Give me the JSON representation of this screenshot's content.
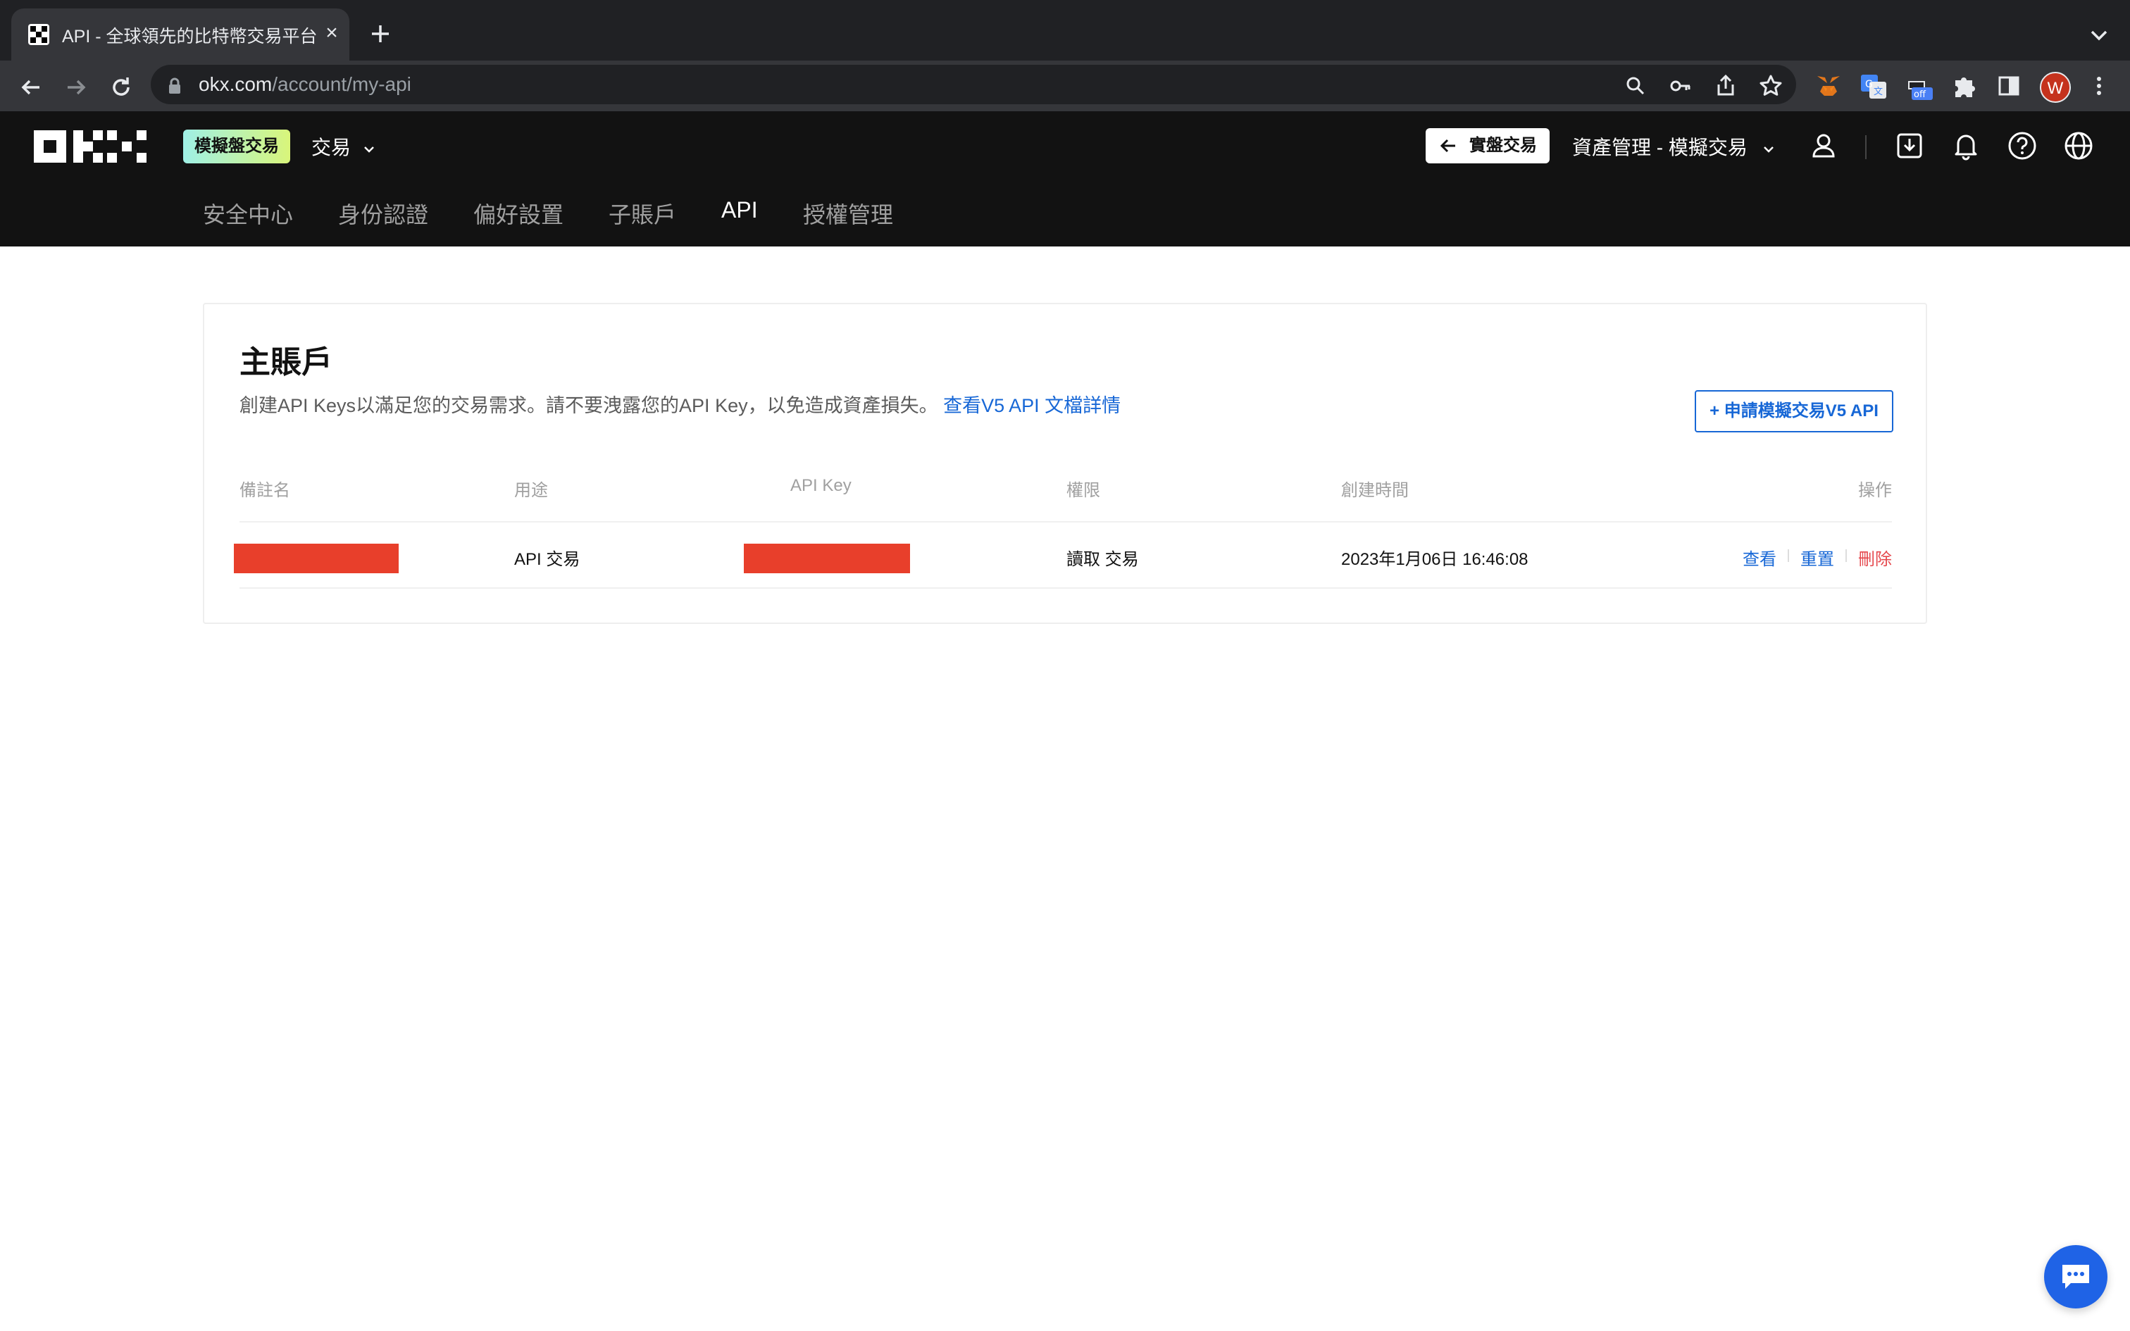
{
  "browser": {
    "tab_title": "API - 全球領先的比特幣交易平台",
    "tab_close": "×",
    "url_host": "okx.com",
    "url_path": "/account/my-api",
    "profile_initial": "W",
    "extension_badge": "off"
  },
  "header": {
    "demo_badge": "模擬盤交易",
    "trade_menu": "交易",
    "real_trade_button": "實盤交易",
    "asset_menu": "資產管理 - 模擬交易"
  },
  "subnav": {
    "items": [
      {
        "label": "安全中心",
        "active": false
      },
      {
        "label": "身份認證",
        "active": false
      },
      {
        "label": "偏好設置",
        "active": false
      },
      {
        "label": "子賬戶",
        "active": false
      },
      {
        "label": "API",
        "active": true
      },
      {
        "label": "授權管理",
        "active": false
      }
    ]
  },
  "main": {
    "title": "主賬戶",
    "description": "創建API Keys以滿足您的交易需求。請不要洩露您的API Key，以免造成資產損失。",
    "doc_link": "查看V5 API 文檔詳情",
    "apply_button": "+ 申請模擬交易V5 API",
    "table": {
      "headers": [
        "備註名",
        "用途",
        "API Key",
        "權限",
        "創建時間",
        "操作"
      ],
      "rows": [
        {
          "name": "",
          "usage": "API 交易",
          "api_key": "",
          "permission": "讀取 交易",
          "created": "2023年1月06日 16:46:08",
          "actions": [
            "查看",
            "重置",
            "刪除"
          ]
        }
      ]
    }
  },
  "colors": {
    "accent": "#1767d6",
    "danger": "#e5484d",
    "redaction": "#e83f2b",
    "header_bg": "#121212"
  },
  "icons": [
    "okx-logo",
    "back-arrow-icon",
    "forward-arrow-icon",
    "reload-icon",
    "lock-icon",
    "zoom-icon",
    "key-icon",
    "share-icon",
    "bookmark-star-icon",
    "metamask-icon",
    "translate-icon",
    "extension-off-icon",
    "puzzle-icon",
    "sidepanel-icon",
    "kebab-menu-icon",
    "user-icon",
    "download-icon",
    "bell-icon",
    "help-icon",
    "globe-icon",
    "chat-icon"
  ]
}
